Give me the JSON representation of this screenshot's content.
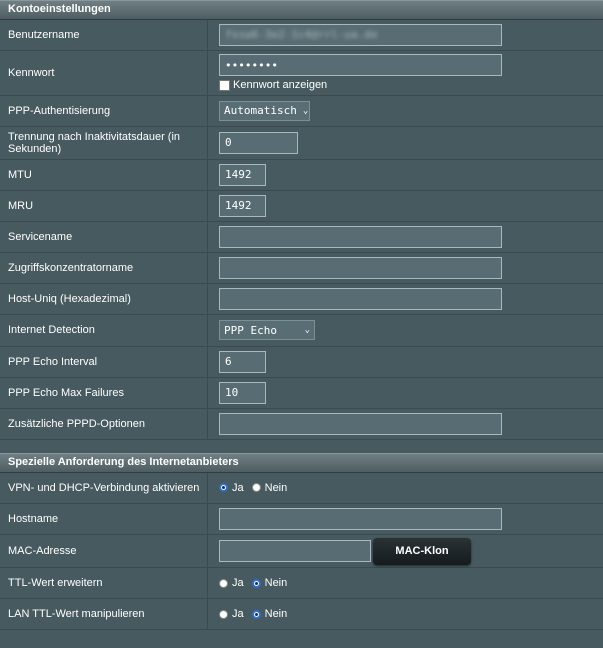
{
  "section1": {
    "title": "Kontoeinstellungen",
    "username_label": "Benutzername",
    "username_value": "fxsw6-3e2-1c4@rrl-ua.de",
    "password_label": "Kennwort",
    "password_value": "••••••••",
    "show_password_label": "Kennwort anzeigen",
    "ppp_auth_label": "PPP-Authentisierung",
    "ppp_auth_value": "Automatisch",
    "idle_label": "Trennung nach Inaktivitatsdauer (in Sekunden)",
    "idle_value": "0",
    "mtu_label": "MTU",
    "mtu_value": "1492",
    "mru_label": "MRU",
    "mru_value": "1492",
    "servicename_label": "Servicename",
    "servicename_value": "",
    "ac_label": "Zugriffskonzentratorname",
    "ac_value": "",
    "hostuniq_label": "Host-Uniq (Hexadezimal)",
    "hostuniq_value": "",
    "detection_label": "Internet Detection",
    "detection_value": "PPP Echo",
    "echo_interval_label": "PPP Echo Interval",
    "echo_interval_value": "6",
    "echo_failures_label": "PPP Echo Max Failures",
    "echo_failures_value": "10",
    "pppd_options_label": "Zusätzliche PPPD-Optionen",
    "pppd_options_value": ""
  },
  "section2": {
    "title": "Spezielle Anforderung des Internetanbieters",
    "vpn_dhcp_label": "VPN- und DHCP-Verbindung aktivieren",
    "hostname_label": "Hostname",
    "hostname_value": "",
    "mac_label": "MAC-Adresse",
    "mac_value": "",
    "mac_clone_button": "MAC-Klon",
    "ttl_label": "TTL-Wert erweitern",
    "lan_ttl_label": "LAN TTL-Wert manipulieren",
    "yes_label": "Ja",
    "no_label": "Nein",
    "vpn_dhcp_selected": "Ja",
    "ttl_selected": "Nein",
    "lan_ttl_selected": "Nein"
  },
  "colors": {
    "background": "#475a5f",
    "radio_selected": "#2a6fd6"
  }
}
